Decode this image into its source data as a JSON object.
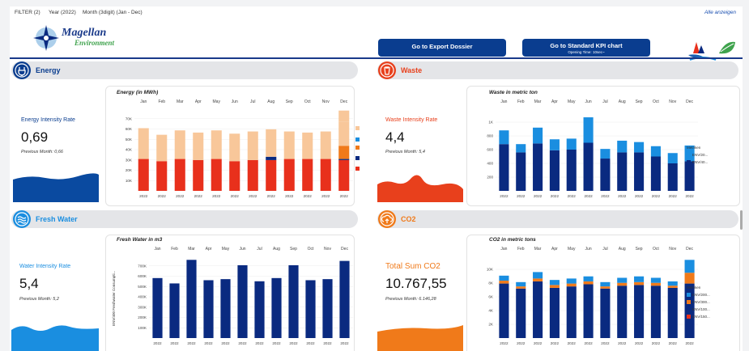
{
  "filter_bar": {
    "filter": "FILTER (2)",
    "year": "Year (2022)",
    "month": "Month (3digit) (Jan - Dec)",
    "show_all": "Alle anzeigen"
  },
  "brand": {
    "name": "Magellan",
    "sub": "Environment"
  },
  "buttons": {
    "export": "Go to Export Dossier",
    "kpi": "Go to Standard KPI chart",
    "kpi_sub": "Opening Time: 10sec~"
  },
  "colors": {
    "navy": "#0a2a80",
    "orange": "#e8501f",
    "peach": "#f8c79a",
    "blue": "#1a8ee0",
    "accent_orange": "#f07a1a"
  },
  "sections": {
    "energy": {
      "title": "Energy",
      "icon": "plug-icon",
      "color": "#0a3d8f",
      "kpi_label": "Energy Intensity Rate",
      "kpi_value": "0,69",
      "kpi_prev": "Previous Month: 0,66",
      "chart_title": "Energy (in MWh)"
    },
    "waste": {
      "title": "Waste",
      "icon": "trash-icon",
      "color": "#e8401c",
      "kpi_label": "Waste Intensity Rate",
      "kpi_value": "4,4",
      "kpi_prev": "Previous Month: 5,4",
      "chart_title": "Waste in metric ton",
      "legend_title": "Metriken",
      "legend": [
        "ENV/20...",
        "ENV/40..."
      ]
    },
    "water": {
      "title": "Fresh Water",
      "icon": "water-icon",
      "color": "#1a8ee0",
      "kpi_label": "Water Intensity Rate",
      "kpi_value": "5,4",
      "kpi_prev": "Previous Month: 5,2",
      "chart_title": "Fresh Water in m3",
      "ylabel": "ENV/400 Freshwater Consumpti..."
    },
    "co2": {
      "title": "CO2",
      "icon": "cloud-upload-icon",
      "color": "#f07a1a",
      "kpi_label": "Total Sum CO2",
      "kpi_value": "10.767,55",
      "kpi_prev": "Previous Month: 6.146,28",
      "chart_title": "CO2 in metric tons",
      "legend_title": "Metriken",
      "legend": [
        "ENV/200...",
        "ENV/300...",
        "ENV/100...",
        "ENV/150..."
      ]
    }
  },
  "chart_data": [
    {
      "type": "bar",
      "title": "Energy (in MWh)",
      "categories": [
        "Jan",
        "Feb",
        "Mar",
        "Apr",
        "May",
        "Jun",
        "Jul",
        "Aug",
        "Sep",
        "Oct",
        "Nov",
        "Dec"
      ],
      "x_sub": "2022",
      "y_ticks": [
        "70K",
        "60K",
        "50K",
        "40K",
        "30K",
        "20K",
        "10K"
      ],
      "ylim": [
        0,
        75000
      ],
      "series": [
        {
          "color": "#e8301c",
          "values": [
            29000,
            27000,
            29000,
            28000,
            29000,
            27000,
            28000,
            28000,
            29000,
            29000,
            29000,
            28000
          ]
        },
        {
          "color": "#0a2a80",
          "values": [
            0,
            0,
            0,
            0,
            0,
            0,
            0,
            3000,
            0,
            0,
            0,
            1000
          ]
        },
        {
          "color": "#f07a1a",
          "values": [
            0,
            0,
            0,
            0,
            0,
            0,
            0,
            0,
            0,
            0,
            0,
            12000
          ]
        },
        {
          "color": "#1a8ee0",
          "values": [
            0,
            0,
            0,
            0,
            0,
            0,
            0,
            0,
            0,
            0,
            0,
            0
          ]
        },
        {
          "color": "#f8c79a",
          "values": [
            28000,
            24000,
            26000,
            25000,
            26000,
            25000,
            26000,
            25000,
            25000,
            24000,
            25000,
            22000
          ]
        },
        {
          "color": "#f8c79a",
          "values": [
            0,
            0,
            0,
            0,
            0,
            0,
            0,
            0,
            0,
            0,
            0,
            10000
          ]
        }
      ]
    },
    {
      "type": "bar",
      "title": "Waste in metric ton",
      "categories": [
        "Jan",
        "Feb",
        "Mar",
        "Apr",
        "May",
        "Jun",
        "Jul",
        "Aug",
        "Sep",
        "Oct",
        "Nov",
        "Dec"
      ],
      "x_sub": "2022",
      "y_ticks": [
        "1K",
        "800",
        "600",
        "400",
        "200"
      ],
      "ylim": [
        0,
        1200
      ],
      "series": [
        {
          "name": "ENV/40...",
          "color": "#0a2a80",
          "values": [
            680,
            560,
            690,
            590,
            600,
            700,
            470,
            560,
            560,
            500,
            400,
            430
          ]
        },
        {
          "name": "ENV/20...",
          "color": "#1a8ee0",
          "values": [
            200,
            120,
            230,
            160,
            160,
            370,
            140,
            170,
            150,
            150,
            150,
            230
          ]
        }
      ]
    },
    {
      "type": "bar",
      "title": "Fresh Water in m3",
      "categories": [
        "Jan",
        "Feb",
        "Mar",
        "Apr",
        "May",
        "Jun",
        "Jul",
        "Aug",
        "Sep",
        "Oct",
        "Nov",
        "Dec"
      ],
      "x_sub": "2022",
      "y_ticks": [
        "700K",
        "600K",
        "500K",
        "400K",
        "300K",
        "200K",
        "100K"
      ],
      "ylim": [
        0,
        770000
      ],
      "series": [
        {
          "color": "#0a2a80",
          "values": [
            560000,
            510000,
            730000,
            540000,
            550000,
            680000,
            530000,
            560000,
            680000,
            540000,
            550000,
            720000
          ]
        }
      ]
    },
    {
      "type": "bar",
      "title": "CO2 in metric tons",
      "categories": [
        "Jan",
        "Feb",
        "Mar",
        "Apr",
        "May",
        "Jun",
        "Jul",
        "Aug",
        "Sep",
        "Oct",
        "Nov",
        "Dec"
      ],
      "x_sub": "2022",
      "y_ticks": [
        "10K",
        "8K",
        "6K",
        "4K",
        "2K"
      ],
      "ylim": [
        0,
        11500
      ],
      "series": [
        {
          "name": "ENV/150...",
          "color": "#e8301c",
          "values": [
            0,
            0,
            0,
            0,
            0,
            0,
            0,
            0,
            0,
            0,
            0,
            0
          ]
        },
        {
          "name": "ENV/100...",
          "color": "#0a2a80",
          "values": [
            7600,
            6900,
            7900,
            7000,
            7200,
            7500,
            6900,
            7300,
            7400,
            7300,
            7000,
            7600
          ]
        },
        {
          "name": "ENV/300...",
          "color": "#f07a1a",
          "values": [
            400,
            300,
            400,
            400,
            400,
            400,
            300,
            400,
            400,
            400,
            300,
            1500
          ]
        },
        {
          "name": "ENV/200...",
          "color": "#1a8ee0",
          "values": [
            700,
            600,
            900,
            700,
            700,
            700,
            600,
            700,
            800,
            700,
            600,
            1800
          ]
        }
      ]
    }
  ]
}
